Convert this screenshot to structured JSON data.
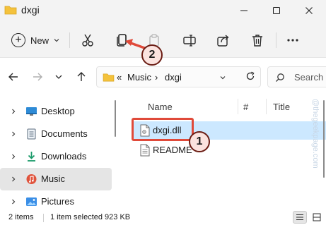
{
  "window": {
    "title": "dxgi"
  },
  "toolbar": {
    "new_label": "New",
    "icons": [
      "cut-icon",
      "copy-icon",
      "paste-icon",
      "rename-icon",
      "share-icon",
      "delete-icon",
      "more-icon"
    ]
  },
  "address": {
    "overflow": "«",
    "crumbs": [
      "Music",
      "dxgi"
    ],
    "separator": "›"
  },
  "search": {
    "placeholder": "Search d"
  },
  "sidebar": {
    "items": [
      {
        "label": "Desktop",
        "icon": "desktop-icon"
      },
      {
        "label": "Documents",
        "icon": "documents-icon"
      },
      {
        "label": "Downloads",
        "icon": "downloads-icon"
      },
      {
        "label": "Music",
        "icon": "music-icon",
        "selected": true
      },
      {
        "label": "Pictures",
        "icon": "pictures-icon"
      }
    ]
  },
  "columns": {
    "name": "Name",
    "number": "#",
    "title": "Title"
  },
  "files": [
    {
      "name": "dxgi.dll",
      "icon": "dll-file-icon",
      "selected": true
    },
    {
      "name": "README",
      "icon": "text-file-icon",
      "selected": false
    }
  ],
  "annotations": {
    "badge_1": "1",
    "badge_2": "2"
  },
  "watermark": "@thegeekpage.com",
  "status": {
    "item_count": "2 items",
    "selection": "1 item selected  923 KB"
  },
  "colors": {
    "highlight": "#e04a3a",
    "selection": "#cce8ff",
    "folder": "#f4c23c"
  }
}
